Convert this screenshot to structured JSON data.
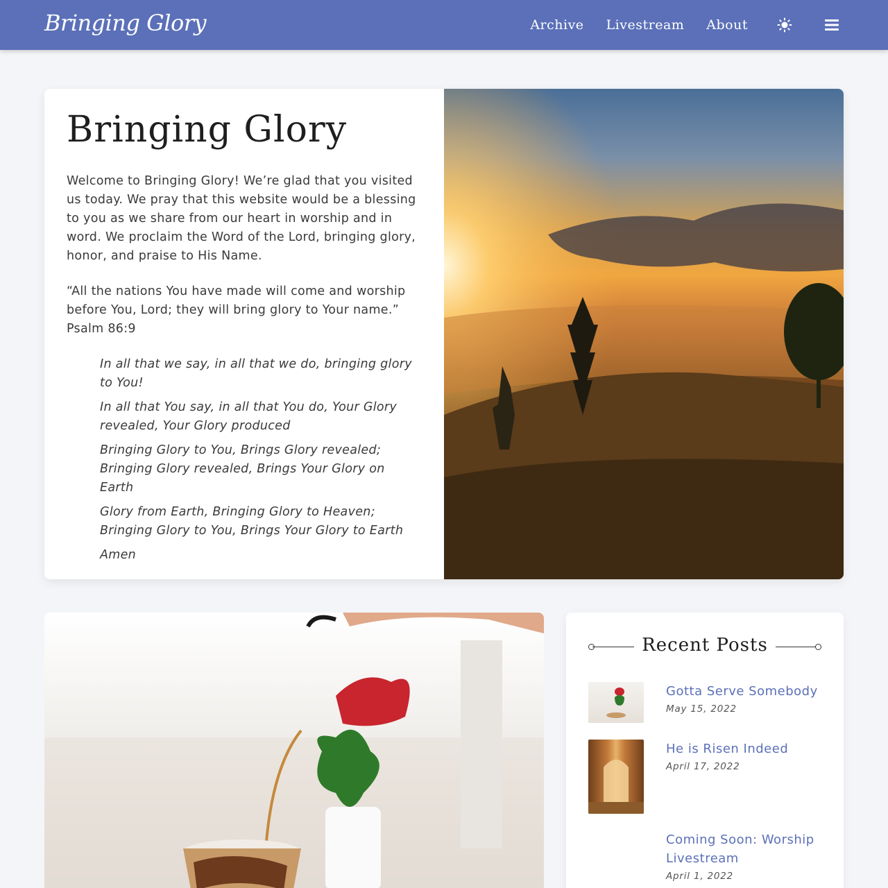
{
  "header": {
    "logo": "Bringing Glory",
    "nav": [
      "Archive",
      "Livestream",
      "About"
    ],
    "theme_icon": "sun-icon",
    "menu_icon": "hamburger-menu-icon"
  },
  "hero": {
    "title": "Bringing Glory",
    "intro": "Welcome to Bringing Glory! We’re glad that you visited us today. We pray that this website would be a blessing to you as we share from our heart in worship and in word. We proclaim the Word of the Lord, bringing glory, honor, and praise to His Name.",
    "verse": "“All the nations You have made will come and worship before You, Lord; they will bring glory to Your name.”",
    "verse_ref": "Psalm 86:9",
    "lyrics": [
      "In all that we say, in all that we do, bringing glory to You!",
      "In all that You say, in all that You do, Your Glory revealed, Your Glory produced",
      "Bringing Glory to You, Brings Glory revealed; Bringing Glory revealed, Brings Your Glory on Earth",
      "Glory from Earth, Bringing Glory to Heaven; Bringing Glory to You, Brings Your Glory to Earth",
      "Amen"
    ]
  },
  "sidebar": {
    "title": "Recent Posts",
    "posts": [
      {
        "title": "Gotta Serve Somebody",
        "date": "May 15, 2022"
      },
      {
        "title": "He is Risen Indeed",
        "date": "April 17, 2022"
      },
      {
        "title": "Coming Soon: Worship Livestream",
        "date": "April 1, 2022"
      }
    ]
  },
  "colors": {
    "header": "#5b70b8",
    "link": "#5b70b8",
    "background": "#f4f5f8"
  }
}
